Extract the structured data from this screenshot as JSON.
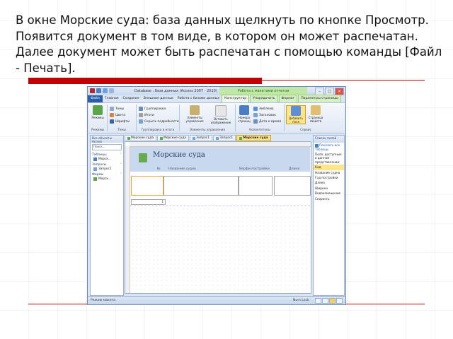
{
  "slide": {
    "text": "В окне Морские суда: база данных щелкнуть по кнопке Просмотр. Появится документ в том виде, в котором он может распечатан. Далее документ может быть распечатан с помощью команды [Файл - Печать]."
  },
  "window": {
    "title": "Database : база данных (Access 2007 - 2010)",
    "context_tab_group": "Работа с макетами отчетов",
    "buttons": [
      "–",
      "□",
      "×"
    ]
  },
  "ribbon_tabs": [
    {
      "label": "Файл"
    },
    {
      "label": "Главная"
    },
    {
      "label": "Создание"
    },
    {
      "label": "Внешние данные"
    },
    {
      "label": "Работа с базами данных"
    },
    {
      "label": "Конструктор"
    },
    {
      "label": "Упорядочить"
    },
    {
      "label": "Формат"
    },
    {
      "label": "Параметры страницы"
    }
  ],
  "ribbon": {
    "groups": [
      {
        "label": "Режимы",
        "big": "Режимы"
      },
      {
        "label": "Темы",
        "items": [
          "Темы",
          "Цвета",
          "Шрифты"
        ]
      },
      {
        "label": "Группировка и итоги",
        "items": [
          "Группировка",
          "Итоги",
          "Скрыть подробности"
        ]
      },
      {
        "label": "Элементы управления",
        "items": [
          "Элементы управления",
          "Вставить изображение"
        ]
      },
      {
        "label": "Колонтитулы",
        "items": [
          "Эмблема",
          "Заголовок",
          "Дата и время",
          "Номера страниц"
        ]
      },
      {
        "label": "Сервис",
        "items": [
          "Добавить поля",
          "Страница свойств"
        ]
      }
    ]
  },
  "nav": {
    "header": "Все объекты Access",
    "search_placeholder": "Поиск...",
    "groups": [
      {
        "label": "Таблицы",
        "items": [
          "Морск..."
        ]
      },
      {
        "label": "Запросы",
        "items": [
          "Запрос1"
        ]
      },
      {
        "label": "Формы",
        "items": [
          "Морск..."
        ]
      }
    ]
  },
  "doc_tabs": [
    "Морские суда",
    "Морские суда",
    "Запрос1",
    "Запрос1",
    "Морские суда"
  ],
  "form": {
    "title": "Морские суда",
    "columns": [
      "№",
      "Название судна",
      "Верфи постройки",
      "Длина"
    ],
    "footer_value": "1"
  },
  "props": {
    "header": "Список полей",
    "items": [
      "Показать все таблицы",
      "Поля, доступные в данном представлении:",
      "Код",
      "Название судна",
      "Год постройки",
      "Длина",
      "Ширина",
      "Водоизмещение",
      "Скорость"
    ]
  },
  "status": {
    "left": "Режим макета",
    "right": "Num Lock"
  },
  "colors": {
    "accent": "#2a5ea8",
    "context": "#bfe7a6",
    "redbar": "#c00000",
    "selected_tab": "#ffe58a"
  }
}
